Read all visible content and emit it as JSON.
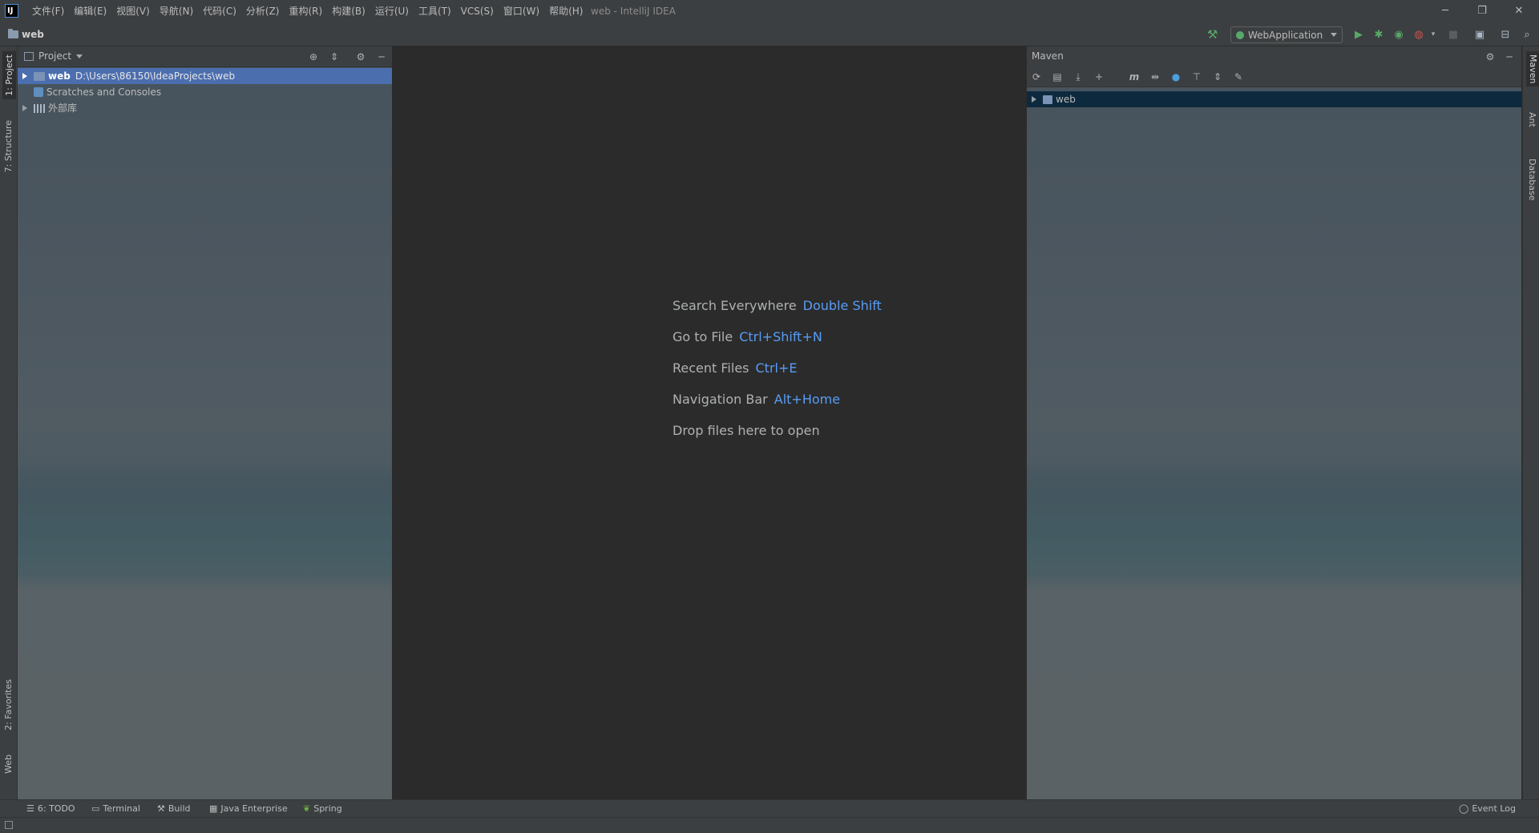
{
  "app": {
    "logo_text": "IJ",
    "window_title": "web - IntelliJ IDEA",
    "window_controls": {
      "minimize": "─",
      "restore": "❐",
      "close": "✕"
    }
  },
  "menu": [
    "文件(F)",
    "编辑(E)",
    "视图(V)",
    "导航(N)",
    "代码(C)",
    "分析(Z)",
    "重构(R)",
    "构建(B)",
    "运行(U)",
    "工具(T)",
    "VCS(S)",
    "窗口(W)",
    "帮助(H)"
  ],
  "navbar": {
    "breadcrumb": "web",
    "run_config": "WebApplication"
  },
  "left_stripe": {
    "project_tab": "1: Project",
    "structure_tab": "7: Structure",
    "favorites_tab": "2: Favorites",
    "web_tab": "Web"
  },
  "right_stripe": {
    "maven_tab": "Maven",
    "ant_tab": "Ant",
    "database_tab": "Database"
  },
  "project_panel": {
    "title": "Project",
    "tree": [
      {
        "name": "web",
        "path": "D:\\Users\\86150\\IdeaProjects\\web"
      },
      {
        "name": "Scratches and Consoles"
      },
      {
        "name": "外部库"
      }
    ]
  },
  "editor": {
    "hints": [
      {
        "label": "Search Everywhere",
        "shortcut": "Double Shift"
      },
      {
        "label": "Go to File",
        "shortcut": "Ctrl+Shift+N"
      },
      {
        "label": "Recent Files",
        "shortcut": "Ctrl+E"
      },
      {
        "label": "Navigation Bar",
        "shortcut": "Alt+Home"
      },
      {
        "label": "Drop files here to open",
        "shortcut": ""
      }
    ]
  },
  "maven_panel": {
    "title": "Maven",
    "tree_root": "web"
  },
  "bottom_tabs": {
    "todo": "6: TODO",
    "terminal": "Terminal",
    "build": "Build",
    "java_enterprise": "Java Enterprise",
    "spring": "Spring",
    "event_log": "Event Log"
  },
  "colors": {
    "accent_blue": "#589df6",
    "selection": "#4b6eaf",
    "maven_selection": "#0d293e",
    "run_green": "#59a869"
  }
}
